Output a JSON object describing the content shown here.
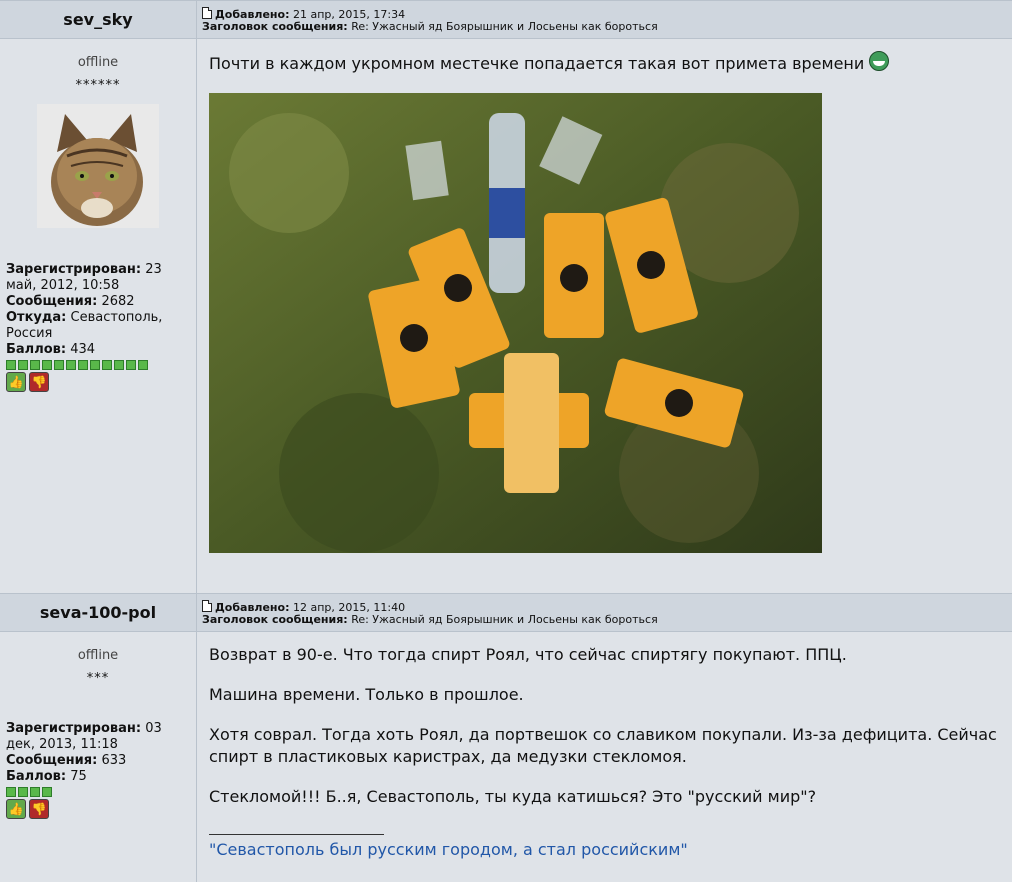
{
  "posts": [
    {
      "author": "sev_sky",
      "added_label": "Добавлено:",
      "added_date": "21 апр, 2015, 17:34",
      "subject_label": "Заголовок сообщения:",
      "subject": "Re: Ужасный яд Боярышник и Лосьены как бороться",
      "status": "offline",
      "stars": "******",
      "registered_label": "Зарегистрирован:",
      "registered_value": "23 май, 2012, 10:58",
      "messages_label": "Сообщения:",
      "messages_value": "2682",
      "from_label": "Откуда:",
      "from_value": "Севастополь, Россия",
      "points_label": "Баллов:",
      "points_value": "434",
      "text": "Почти в каждом укромном местечке попадается такая вот примета времени"
    },
    {
      "author": "seva-100-pol",
      "added_label": "Добавлено:",
      "added_date": "12 апр, 2015, 11:40",
      "subject_label": "Заголовок сообщения:",
      "subject": "Re: Ужасный яд Боярышник и Лосьены как бороться",
      "status": "offline",
      "stars": "***",
      "registered_label": "Зарегистрирован:",
      "registered_value": "03 дек, 2013, 11:18",
      "messages_label": "Сообщения:",
      "messages_value": "633",
      "points_label": "Баллов:",
      "points_value": "75",
      "paragraphs": [
        "Возврат в 90-е. Что тогда спирт Роял, что сейчас спиртягу покупают. ППЦ.",
        "Машина времени. Только в прошлое.",
        "Хотя соврал. Тогда хоть Роял, да портвешок со славиком покупали. Из-за дефицита. Сейчас спирт в пластиковых каристрах, да медузки стекломоя.",
        "Стекломой!!! Б..я, Севастополь, ты куда катишься? Это \"русский мир\"?"
      ],
      "signature": "\"Севастополь был русским городом, а стал российским\""
    }
  ],
  "icons": {
    "post_icon": "document-icon",
    "smiley": "grin-smiley-icon",
    "thumb_up": "thumbs-up-icon",
    "thumb_down": "thumbs-down-icon"
  },
  "colors": {
    "header_bg": "#cfd6de",
    "page_bg": "#dfe3e8",
    "signature": "#2157a8",
    "reputation": "#59b84a"
  }
}
